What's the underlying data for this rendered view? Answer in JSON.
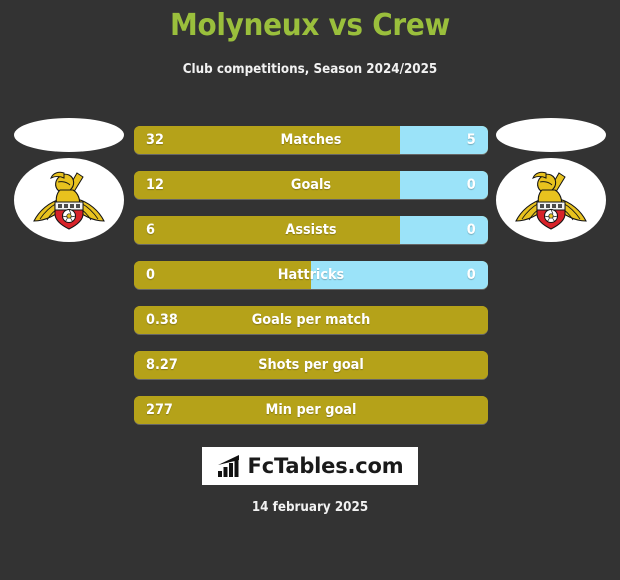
{
  "header": {
    "title": "Molyneux vs Crew",
    "subtitle": "Club competitions, Season 2024/2025",
    "title_color": "#9ABF3C"
  },
  "colors": {
    "background": "#333333",
    "home_bar": "#B5A219",
    "away_bar": "#9BE3F9",
    "text": "#FFFFFF"
  },
  "players": {
    "left": {
      "crest_name": "doncaster-rovers-crest"
    },
    "right": {
      "crest_name": "doncaster-rovers-crest"
    }
  },
  "stats": [
    {
      "label": "Matches",
      "home": "32",
      "away": "5",
      "home_pct": 75,
      "has_away": true
    },
    {
      "label": "Goals",
      "home": "12",
      "away": "0",
      "home_pct": 75,
      "has_away": true
    },
    {
      "label": "Assists",
      "home": "6",
      "away": "0",
      "home_pct": 75,
      "has_away": true
    },
    {
      "label": "Hattricks",
      "home": "0",
      "away": "0",
      "home_pct": 50,
      "has_away": true
    },
    {
      "label": "Goals per match",
      "home": "0.38",
      "away": "",
      "home_pct": 100,
      "has_away": false
    },
    {
      "label": "Shots per goal",
      "home": "8.27",
      "away": "",
      "home_pct": 100,
      "has_away": false
    },
    {
      "label": "Min per goal",
      "home": "277",
      "away": "",
      "home_pct": 100,
      "has_away": false
    }
  ],
  "footer": {
    "brand": "FcTables.com",
    "brand_icon": "bar-chart-icon",
    "date": "14 february 2025"
  }
}
